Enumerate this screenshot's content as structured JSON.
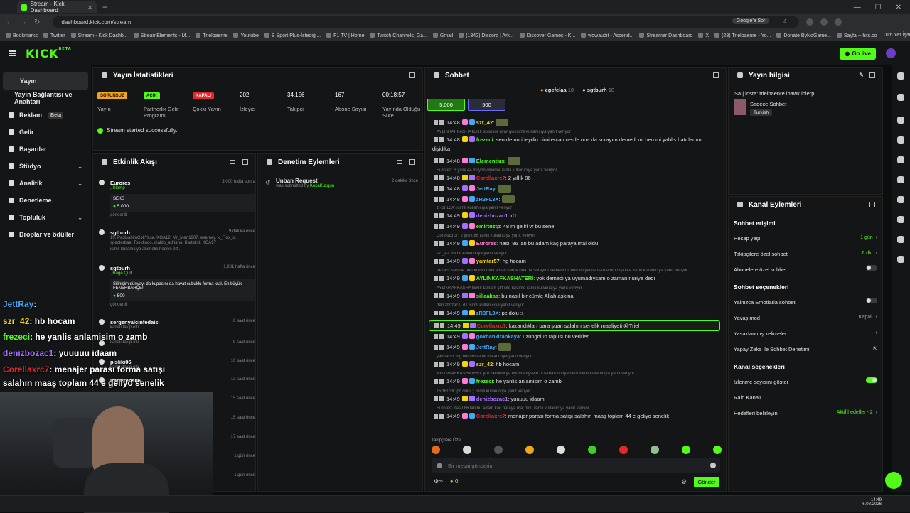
{
  "browser": {
    "tab_title": "Stream - Kick Dashboard",
    "url": "dashboard.kick.com/stream",
    "google_search": "Google'a Sor",
    "bookmarks": [
      "Bookmarks",
      "Twitter",
      "Stream - Kick Dashb...",
      "StreamElements - M...",
      "Trielbaenre",
      "Youtube",
      "S Sport Plus-İstediği...",
      "F1 TV | Home",
      "Twitch Channels, Ga...",
      "Gmail",
      "(1342) Discord | Ark...",
      "Discover Games - K...",
      "wowaudit - Ascend...",
      "Streamer Dashboard",
      "X",
      "(23) Trielbaenre - Yo...",
      "Donate ByNoGame...",
      "Sayfa -- hits.co"
    ],
    "all_bookmarks": "Tüm Yer İşaretleri"
  },
  "header": {
    "logo": "KICK",
    "beta": "BETA",
    "go_live": "Go live"
  },
  "sidebar": {
    "items": [
      {
        "label": "Yayın"
      },
      {
        "label": "Yayın Bağlantısı ve Anahtarı"
      },
      {
        "label": "Reklam",
        "badge": "Beta"
      },
      {
        "label": "Gelir"
      },
      {
        "label": "Başarılar"
      },
      {
        "label": "Stüdyo"
      },
      {
        "label": "Analitik"
      },
      {
        "label": "Denetleme"
      },
      {
        "label": "Topluluk"
      },
      {
        "label": "Droplar ve ödüller"
      }
    ]
  },
  "stats": {
    "title": "Yayın İstatistikleri",
    "items": [
      {
        "badge": "SORUNSUZ",
        "label": "Yayın",
        "color": "#f2a516"
      },
      {
        "badge": "AÇIK",
        "label": "Partnerlik Gelir Programı",
        "color": "#53fc18"
      },
      {
        "badge": "KAPALI",
        "label": "Çoklu Yayın",
        "color": "#e5262b"
      },
      {
        "value": "202",
        "label": "İzleyici"
      },
      {
        "value": "34.156",
        "label": "Takipçi"
      },
      {
        "value": "167",
        "label": "Abone Sayısı"
      },
      {
        "value": "00:18:57",
        "label": "Yayında Olduğu Süre"
      }
    ],
    "status": "Stream started successfully."
  },
  "activity": {
    "title": "Etkinlik Akışı",
    "items": [
      {
        "name": "Eurores",
        "sub": ", Stomp",
        "time": "3.000 hafta sonra",
        "box": "SEKS",
        "amount": "5.000",
        "foot": "gönderdi"
      },
      {
        "name": "sgtburh",
        "sub": "10, PadisahimCokYasa, KOA12, Mr_Mert1907, esarney, x_Flux_x, specterbae, Tookkooo, diablo_adriano, Kartalist, KOA97",
        "time": "9 dakika önce",
        "foot": "isimli kullanıcıya abonelik hediye etti."
      },
      {
        "name": "sgtburh",
        "sub": ", Rage Quit",
        "time": "1.981 hafta önce",
        "box": "Silinişim dünyayı da kupasını da hayat çubuklu forma kral. En büyük FENERBAHÇE!",
        "amount": "500",
        "foot": "gönderdi"
      },
      {
        "name": "sergenyalcinfedaisi",
        "sub": "kanalı takip etti",
        "time": "8 saat önce"
      },
      {
        "name": "",
        "sub": "kanalı takip etti",
        "time": "9 saat önce"
      },
      {
        "name": "pisliki06",
        "sub": "kanalı takip etti",
        "time": "10 saat önce"
      },
      {
        "name": "IranPrens06",
        "sub": "",
        "time": "13 saat önce"
      },
      {
        "name": "",
        "sub": "",
        "time": "15 saat önce"
      },
      {
        "name": "",
        "sub": "",
        "time": "15 saat önce"
      },
      {
        "name": "",
        "sub": "",
        "time": "17 saat önce"
      },
      {
        "name": "",
        "sub": "",
        "time": "1 gün önce"
      },
      {
        "name": "",
        "sub": "",
        "time": "1 gün önce"
      }
    ]
  },
  "moderation": {
    "title": "Denetim Eylemleri",
    "items": [
      {
        "title": "Unban Request",
        "sub": "was submitted by",
        "user": "KocaKuzgun",
        "time": "2 dakika önce"
      }
    ]
  },
  "chat": {
    "title": "Sohbet",
    "top_gifters": [
      {
        "name": "egefelaa",
        "count": "10"
      },
      {
        "name": "sgtburh",
        "count": "10"
      }
    ],
    "goals": [
      "5.000",
      "500"
    ],
    "lines": [
      {
        "type": "msg",
        "time": "14:48",
        "user": "szr_42",
        "color": "#f5d60c",
        "text": ""
      },
      {
        "type": "reply",
        "text": "AYLINKAFKASHATERI: sponsor ayarlıyo isimli kullanıcıya yanıt veriyor"
      },
      {
        "type": "msg",
        "time": "14:48",
        "user": "frezeci",
        "color": "#53fc18",
        "text": "sen de nurideydin dimi ercan nerde ona da sorayım demedi mi ben mi yablis hatırladım"
      },
      {
        "type": "cont",
        "text": "dişidika"
      },
      {
        "type": "msg",
        "time": "14:48",
        "user": "Elementiux",
        "color": "#53fc18",
        "text": ""
      },
      {
        "type": "reply",
        "text": "Eurores: 3 yıllık 44 milyon diyorlar isimli kullanıcıya yanıt veriyor"
      },
      {
        "type": "msg",
        "time": "14:48",
        "user": "Corellaxrc7",
        "color": "#e5262b",
        "text": "2 yıllık 86"
      },
      {
        "type": "msg",
        "time": "14:48",
        "user": "JettRay",
        "color": "#3fa9f5",
        "text": ""
      },
      {
        "type": "msg",
        "time": "14:48",
        "user": "zR3FL3X",
        "color": "#3fa9f5",
        "text": ""
      },
      {
        "type": "reply",
        "text": "zR3FL3X: isimli kullanıcıya yanıt veriyor"
      },
      {
        "type": "msg",
        "time": "14:49",
        "user": "denizbozac1",
        "color": "#a570ff",
        "text": "d1"
      },
      {
        "type": "msg",
        "time": "14:49",
        "user": "emirtnztp",
        "color": "#53fc18",
        "text": "48 m geliri vr bu sene"
      },
      {
        "type": "reply",
        "text": "Corellaxrc7: 2 yıllık 86 isimli kullanıcıya yanıt veriyor"
      },
      {
        "type": "msg",
        "time": "14:49",
        "user": "Eurores",
        "color": "#ff7ad9",
        "text": "nasıl 86 lan bu adam kaç paraya mal oldu"
      },
      {
        "type": "reply",
        "text": "szr_42: isimli kullanıcıya yanıt veriyor"
      },
      {
        "type": "msg",
        "time": "14:49",
        "user": "yamtar57",
        "color": "#f5d60c",
        "text": "hg hocam"
      },
      {
        "type": "reply",
        "text": "frezeci: sen de nurideydin dimi ercan nerde ona da sorayım demedi mi ben mi yablis hatırladım dişidika isimli kullanıcıya yanıt veriyor"
      },
      {
        "type": "msg",
        "time": "14:49",
        "user": "AYLINKAFKASHATERI",
        "color": "#53fc18",
        "text": "yok demedi ya uyumadıysam o zaman nuriye dedi"
      },
      {
        "type": "reply",
        "text": "AYLINKAFKASHATERI: tamam çift site üzülme isimli kullanıcıya yanıt veriyor"
      },
      {
        "type": "msg",
        "time": "14:49",
        "user": "sillaakaa",
        "color": "#53fc18",
        "text": "bu nasıl bir cümle Allah aşkına"
      },
      {
        "type": "reply",
        "text": "denizbozac1: d1 isimli kullanıcıya yanıt veriyor"
      },
      {
        "type": "msg",
        "time": "14:49",
        "user": "zR3FL3X",
        "color": "#3fa9f5",
        "text": "pc dolu :("
      },
      {
        "type": "msg",
        "time": "14:49",
        "user": "Corellaxrc7",
        "color": "#e5262b",
        "text": "kazandıkları para şuan salahın senelik maaliyeti @Triel",
        "highlight": true
      },
      {
        "type": "msg",
        "time": "14:49",
        "user": "gokhankirankaya",
        "color": "#3fa9f5",
        "text": "uzungölün tapusunu verirler"
      },
      {
        "type": "msg",
        "time": "14:49",
        "user": "JettRay",
        "color": "#3fa9f5",
        "text": ""
      },
      {
        "type": "reply",
        "text": "yamtar57: hg hocam isimli kullanıcıya yanıt veriyor"
      },
      {
        "type": "msg",
        "time": "14:49",
        "user": "szr_42",
        "color": "#f5d60c",
        "text": "hb hocam"
      },
      {
        "type": "reply",
        "text": "AYLINKAFKASHATERI: yok demedi ya uyumadıysam o zaman nuriye dedi isimli kullanıcıya yanıt veriyor"
      },
      {
        "type": "msg",
        "time": "14:49",
        "user": "frezeci",
        "color": "#53fc18",
        "text": "he yanlis anlamisim o zamb"
      },
      {
        "type": "reply",
        "text": "zR3FL3X: pc dolu :( isimli kullanıcıya yanıt veriyor"
      },
      {
        "type": "msg",
        "time": "14:49",
        "user": "denizbozac1",
        "color": "#a570ff",
        "text": "yuuuuu idaam"
      },
      {
        "type": "reply",
        "text": "Eurores: nasıl 86 lan bu adam kaç paraya mal oldu isimli kullanıcıya yanıt veriyor"
      },
      {
        "type": "msg",
        "time": "14:49",
        "user": "Corellaxrc7",
        "color": "#e5262b",
        "text": "menajer parası forma satışı salahın maaş toplam 44 e geliyo senelik"
      }
    ],
    "emote_label": "Takipçilere Özel",
    "input_placeholder": "Bir mesaj gönderin",
    "points": "0",
    "send": "Gönder"
  },
  "info": {
    "title": "Yayın bilgisi",
    "stream_title": "Sa | insta: trielbaenre lhawk lblerp",
    "category": "Sadece Sohbet",
    "language": "Turkish"
  },
  "channel": {
    "title": "Kanal Eylemleri",
    "sections": [
      {
        "title": "Sohbet erişimi",
        "rows": [
          {
            "label": "Hesap yaşı",
            "value": "1 gün",
            "kind": "link"
          },
          {
            "label": "Takipçilere özel sohbet",
            "value": "6 dk.",
            "kind": "link"
          },
          {
            "label": "Abonelere özel sohbet",
            "kind": "toggle",
            "on": false
          }
        ]
      },
      {
        "title": "Sohbet seçenekleri",
        "rows": [
          {
            "label": "Yalnızca Emotlarla sohbet",
            "kind": "toggle",
            "on": false
          },
          {
            "label": "Yavaş mod",
            "value": "Kapalı",
            "kind": "link"
          },
          {
            "label": "Yasaklanmış kelimeler",
            "kind": "link"
          },
          {
            "label": "Yapay Zeka ile Sohbet Denetimi",
            "kind": "ext"
          }
        ]
      },
      {
        "title": "Kanal seçenekleri",
        "rows": [
          {
            "label": "İzlenme sayısını göster",
            "kind": "toggle",
            "on": true
          },
          {
            "label": "Raid Kanalı",
            "kind": "none"
          },
          {
            "label": "Hedefleri belirleyin",
            "value": "Aktif hedefler - 2",
            "kind": "link"
          }
        ]
      }
    ]
  },
  "overlay": {
    "lines": [
      {
        "user": "JettRay",
        "text": ":",
        "color": "#3fa9f5"
      },
      {
        "user": "szr_42",
        "text": ": hb hocam",
        "color": "#f5d60c"
      },
      {
        "user": "frezeci",
        "text": ": he yanlis anlamisim o zamb",
        "color": "#53fc18"
      },
      {
        "user": "denizbozac1",
        "text": ": yuuuuu idaam",
        "color": "#a570ff"
      },
      {
        "user": "Corellaxrc7",
        "text": ": menajer parası forma satışı",
        "color": "#e5262b"
      },
      {
        "user": "",
        "text": "salahın maaş toplam 44 e geliyo senelik",
        "color": "#ffffff"
      }
    ]
  },
  "clock": {
    "time": "14:49",
    "date": "6.08.2026"
  }
}
